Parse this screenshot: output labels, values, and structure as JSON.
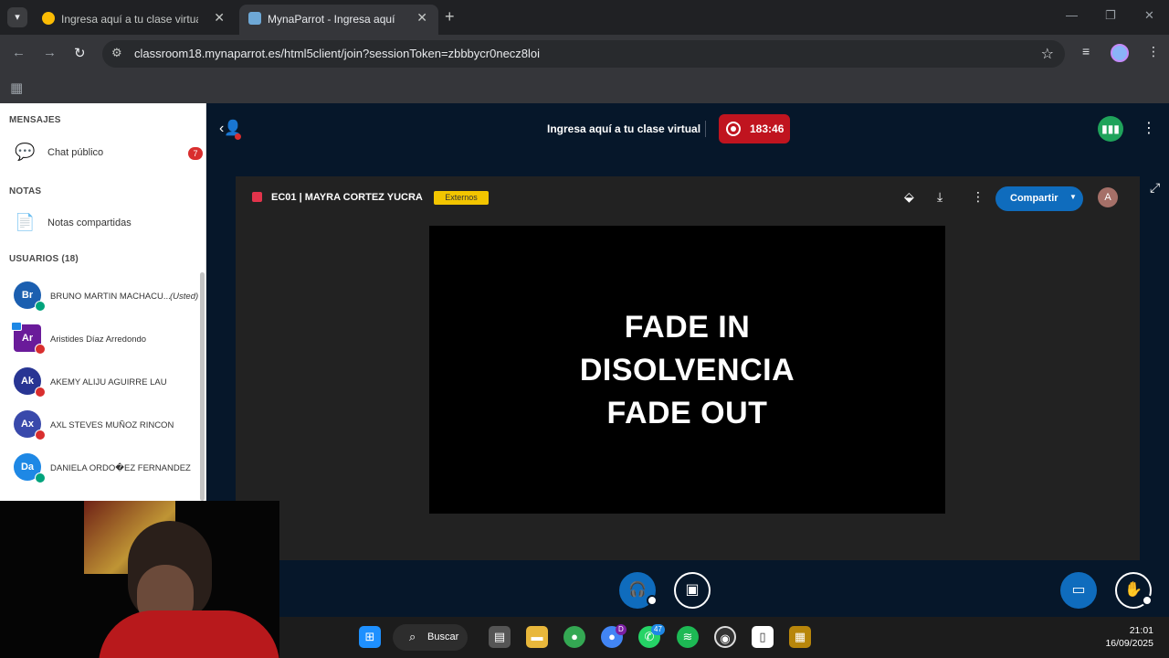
{
  "browser": {
    "tabs": [
      {
        "title": "Ingresa aquí a tu clase virtual",
        "active": false
      },
      {
        "title": "MynaParrot - Ingresa aquí a tu clase virtual",
        "active": true
      }
    ],
    "url": "classroom18.mynaparrot.es/html5client/join?sessionToken=zbbbycr0necz8loi"
  },
  "sidebar": {
    "messages_header": "MENSAJES",
    "public_chat": "Chat público",
    "public_chat_badge": "7",
    "notes_header": "NOTAS",
    "shared_notes": "Notas compartidas",
    "users_header": "USUARIOS (18)",
    "you_label": "(Usted)",
    "users": [
      {
        "initials": "Br",
        "name": "BRUNO MARTIN MACHACU...",
        "color": "#1b5fb0",
        "mic": "on"
      },
      {
        "initials": "Ar",
        "name": "Aristides Díaz Arredondo",
        "color": "#6a1b9a",
        "mic": "off"
      },
      {
        "initials": "Ak",
        "name": "AKEMY ALIJU AGUIRRE LAU",
        "color": "#283593",
        "mic": "off"
      },
      {
        "initials": "Ax",
        "name": "AXL STEVES MUÑOZ RINCON",
        "color": "#3949ab",
        "mic": "off"
      },
      {
        "initials": "Da",
        "name": "DANIELA ORDO�EZ FERNANDEZ",
        "color": "#1e88e5",
        "mic": "on"
      }
    ]
  },
  "meeting": {
    "title": "Ingresa aquí a tu clase virtual",
    "recording_time": "183:46",
    "presenter": "EC01 | MAYRA CORTEZ YUCRA",
    "external_tag": "Externos",
    "share_label": "Compartir",
    "user_initial": "A",
    "slide_lines": [
      "FADE IN",
      "DISOLVENCIA",
      "FADE OUT"
    ]
  },
  "taskbar": {
    "search_label": "Buscar",
    "whatsapp_badge": "47",
    "chrome_badge": "D",
    "time": "21:01",
    "date": "16/09/2025"
  },
  "colors": {
    "accent_blue": "#0f6cbd",
    "record_red": "#c0141f",
    "main_bg": "#06172a",
    "external_yellow": "#f2c500"
  }
}
